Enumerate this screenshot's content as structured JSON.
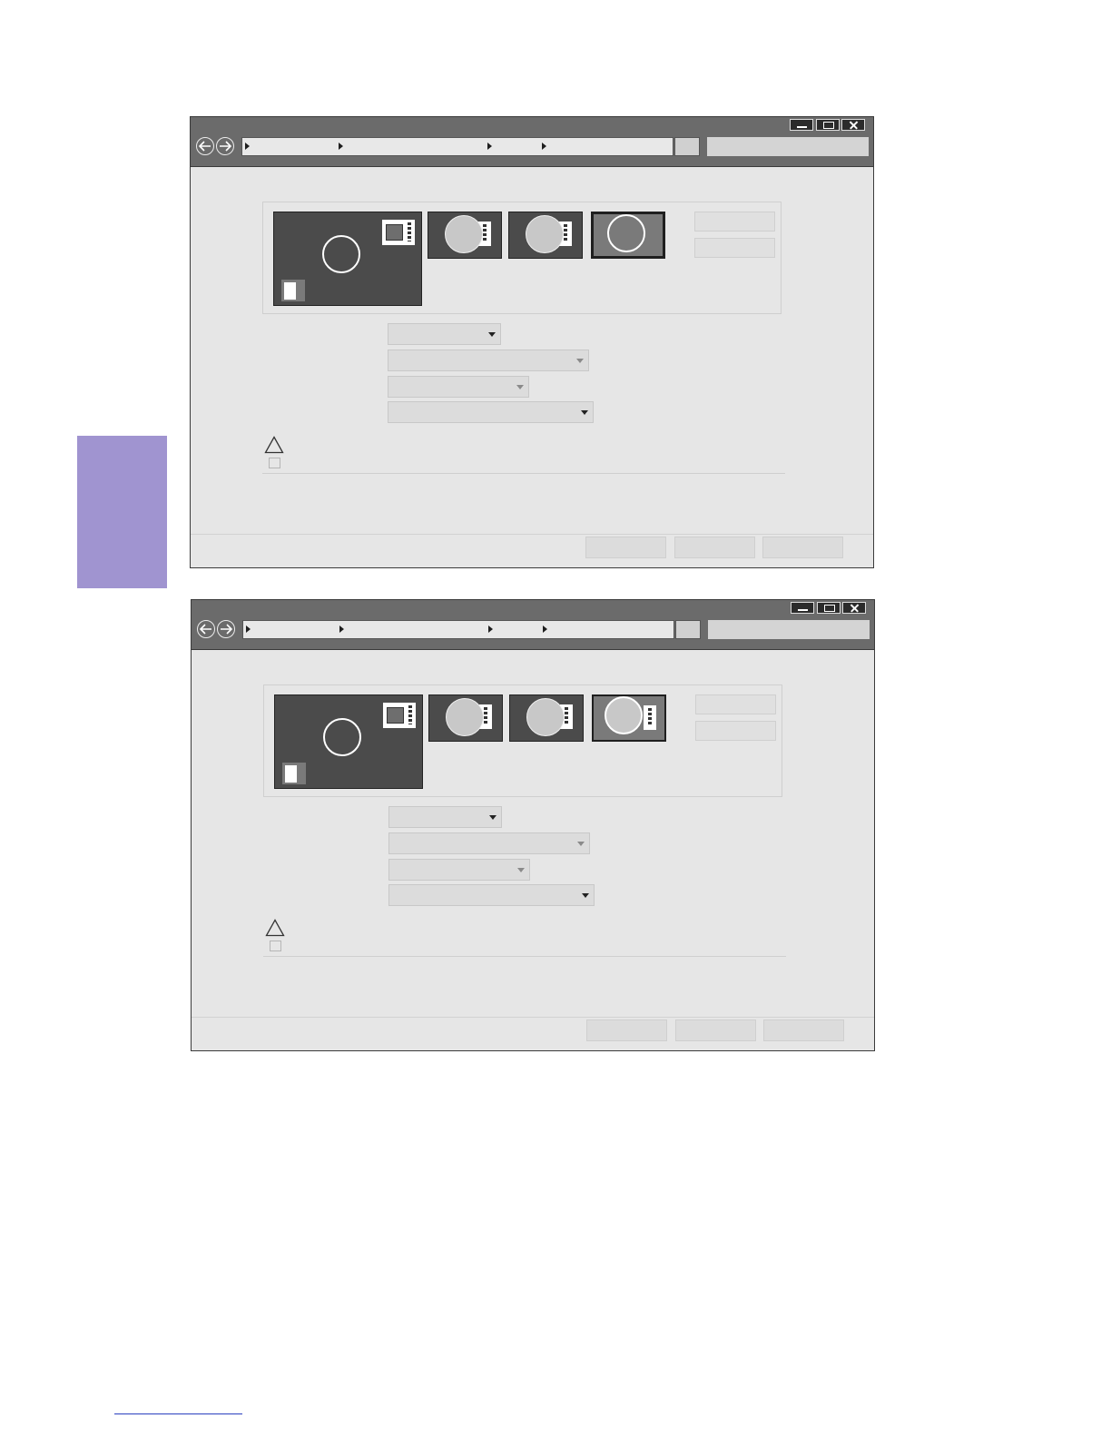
{
  "windows": [
    {
      "id": "window-1",
      "selected_thumbnail": 3,
      "window_controls": [
        "minimize-icon",
        "maximize-icon",
        "close-icon"
      ],
      "navigation": {
        "back_icon": "arrow-left-icon",
        "forward_icon": "arrow-right-icon"
      },
      "address_bar": {
        "breadcrumb_separators": 4,
        "text": ""
      },
      "search": {
        "placeholder": ""
      },
      "layout_thumbnails": [
        "layout-1",
        "layout-2",
        "layout-3",
        "layout-4"
      ],
      "side_buttons": [
        "",
        ""
      ],
      "dropdowns": [
        {
          "value": "",
          "caret": "dark"
        },
        {
          "value": "",
          "caret": "light"
        },
        {
          "value": "",
          "caret": "light"
        },
        {
          "value": "",
          "caret": "dark"
        }
      ],
      "warning_icon": "warning-triangle-icon",
      "checkbox_checked": false,
      "footer_buttons": [
        "",
        "",
        ""
      ]
    },
    {
      "id": "window-2",
      "selected_thumbnail": 3,
      "window_controls": [
        "minimize-icon",
        "maximize-icon",
        "close-icon"
      ],
      "navigation": {
        "back_icon": "arrow-left-icon",
        "forward_icon": "arrow-right-icon"
      },
      "address_bar": {
        "breadcrumb_separators": 4,
        "text": ""
      },
      "search": {
        "placeholder": ""
      },
      "layout_thumbnails": [
        "layout-1",
        "layout-2",
        "layout-3",
        "layout-4"
      ],
      "side_buttons": [
        "",
        ""
      ],
      "dropdowns": [
        {
          "value": "",
          "caret": "dark"
        },
        {
          "value": "",
          "caret": "light"
        },
        {
          "value": "",
          "caret": "light"
        },
        {
          "value": "",
          "caret": "dark"
        }
      ],
      "warning_icon": "warning-triangle-icon",
      "checkbox_checked": false,
      "footer_buttons": [
        "",
        "",
        ""
      ]
    }
  ],
  "colors": {
    "side_tab": "#a094d0",
    "title_bar": "#6b6b6b",
    "window_body": "#e6e6e6",
    "preview_dark": "#4b4b4b",
    "footer_rule": "#2a3fbf"
  }
}
